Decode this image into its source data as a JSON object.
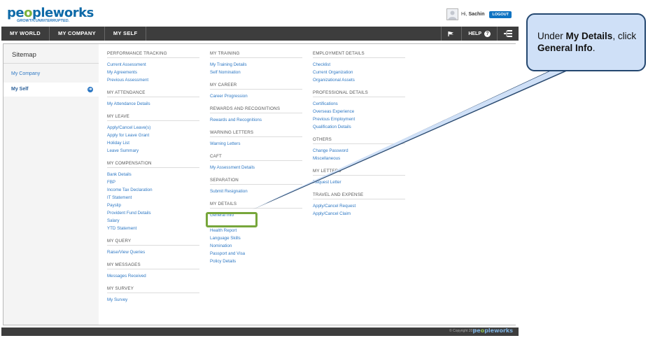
{
  "header": {
    "logo_text": "peopleworks",
    "logo_tagline": "GROWTH.UNINTERRUPTED.",
    "greeting": "Hi,",
    "user_name": "Sachin",
    "logout_label": "LOGOUT"
  },
  "nav": {
    "items": [
      "MY WORLD",
      "MY COMPANY",
      "MY SELF"
    ],
    "help_label": "HELP"
  },
  "sidebar": {
    "title": "Sitemap",
    "items": [
      "My Company",
      "My Self"
    ]
  },
  "columns": [
    [
      {
        "heading": "PERFORMANCE TRACKING",
        "links": [
          "Current Assessment",
          "My Agreements",
          "Previous Assessment"
        ]
      },
      {
        "heading": "MY ATTENDANCE",
        "links": [
          "My Attendance Details"
        ]
      },
      {
        "heading": "MY LEAVE",
        "links": [
          "Apply/Cancel Leave(s)",
          "Apply for Leave Grant",
          "Holiday List",
          "Leave Summary"
        ]
      },
      {
        "heading": "MY COMPENSATION",
        "links": [
          "Bank Details",
          "FBP",
          "Income Tax Declaration",
          "IT Statement",
          "Payslip",
          "Provident Fund Details",
          "Salary",
          "YTD Statement"
        ]
      },
      {
        "heading": "MY QUERY",
        "links": [
          "Raise/View Queries"
        ]
      },
      {
        "heading": "MY MESSAGES",
        "links": [
          "Messages Received"
        ]
      },
      {
        "heading": "MY SURVEY",
        "links": [
          "My Survey"
        ]
      }
    ],
    [
      {
        "heading": "MY TRAINING",
        "links": [
          "My Training Details",
          "Self Nomination"
        ]
      },
      {
        "heading": "MY CAREER",
        "links": [
          "Career Progression"
        ]
      },
      {
        "heading": "REWARDS AND RECOGNITIONS",
        "links": [
          "Rewards and Recognitions"
        ]
      },
      {
        "heading": "WARNING LETTERS",
        "links": [
          "Warning Letters"
        ]
      },
      {
        "heading": "CAFT",
        "links": [
          "My Assessment Details"
        ]
      },
      {
        "heading": "SEPARATION",
        "links": [
          "Submit Resignation"
        ]
      },
      {
        "heading": "MY DETAILS",
        "links": [
          "General Info",
          "",
          "Health Report",
          "Language Skills",
          "Nomination",
          "Passport and Visa",
          "Policy Details"
        ]
      }
    ],
    [
      {
        "heading": "EMPLOYMENT DETAILS",
        "links": [
          "Checklist",
          "Current Organization",
          "Organizational Assets"
        ]
      },
      {
        "heading": "PROFESSIONAL DETAILS",
        "links": [
          "Certifications",
          "Overseas Experience",
          "Previous Employment",
          "Qualification Details"
        ]
      },
      {
        "heading": "OTHERS",
        "links": [
          "Change Password",
          "Miscellaneous"
        ]
      },
      {
        "heading": "MY LETTERS",
        "links": [
          "Request Letter"
        ]
      },
      {
        "heading": "TRAVEL AND EXPENSE",
        "links": [
          "Apply/Cancel Request",
          "Apply/Cancel Claim"
        ]
      }
    ]
  ],
  "footer": {
    "copyright": "© Copyright 2014",
    "logo_text": "peopleworks"
  },
  "callout": {
    "prefix": "Under ",
    "bold1": "My Details",
    "middle": ", click ",
    "bold2": "General Info",
    "suffix": "."
  },
  "colors": {
    "accent": "#2f79c4",
    "nav_bg": "#3d3d3d",
    "highlight": "#77a63b",
    "callout_bg": "#cfe0f7",
    "callout_border": "#24476f"
  }
}
